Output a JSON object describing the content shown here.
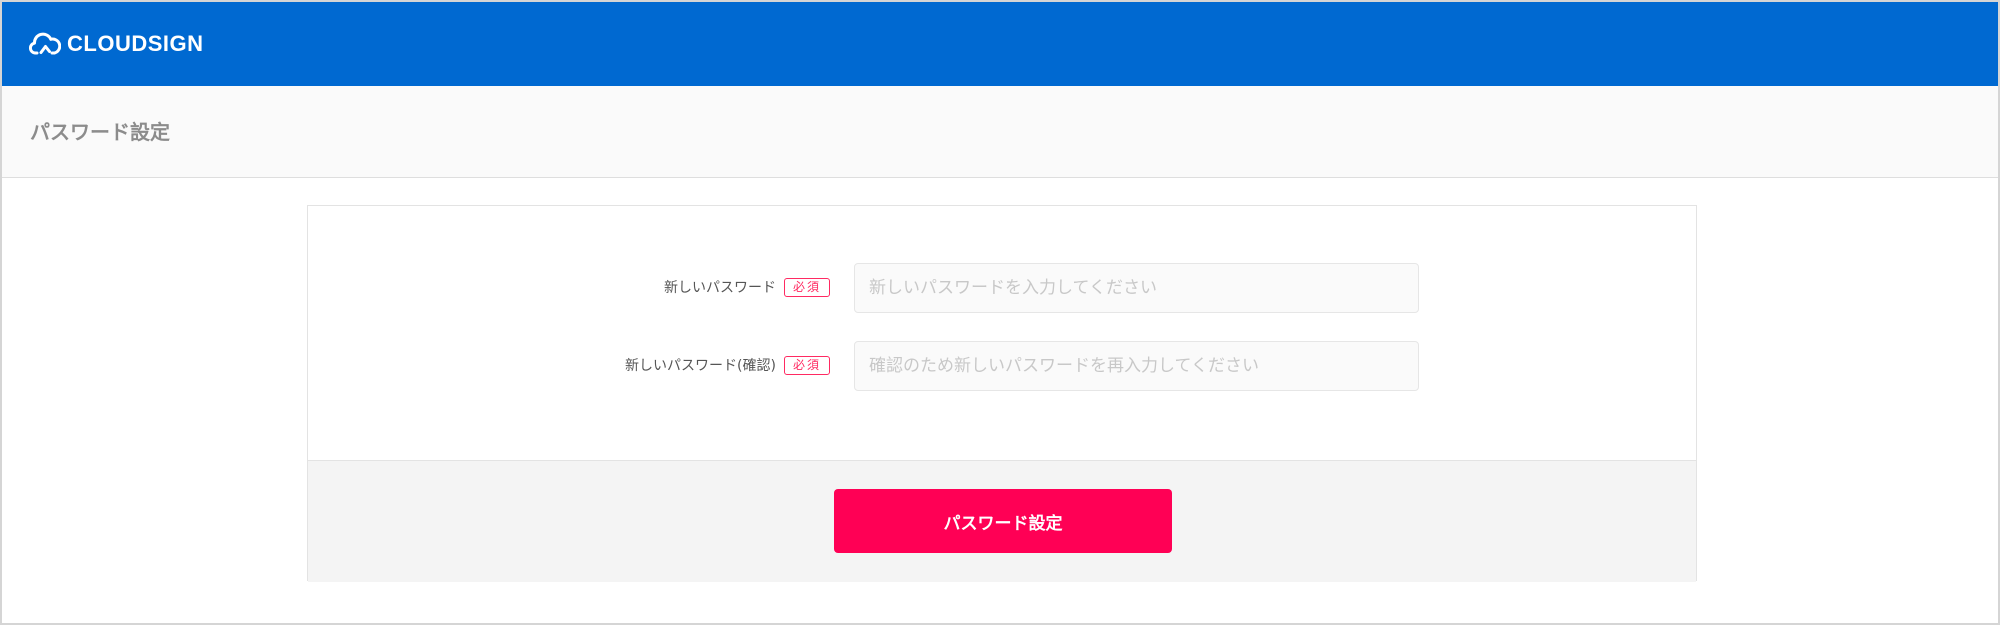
{
  "brand": {
    "name": "CLOUDSIGN"
  },
  "page": {
    "title": "パスワード設定"
  },
  "form": {
    "fields": [
      {
        "label": "新しいパスワード",
        "required_badge": "必須",
        "placeholder": "新しいパスワードを入力してください",
        "value": ""
      },
      {
        "label": "新しいパスワード(確認)",
        "required_badge": "必須",
        "placeholder": "確認のため新しいパスワードを再入力してください",
        "value": ""
      }
    ],
    "submit_label": "パスワード設定"
  },
  "colors": {
    "header": "#0069d1",
    "accent": "#ff0055",
    "required": "#ff2a62"
  },
  "icons": {
    "logo": "cloud-sign-icon"
  }
}
